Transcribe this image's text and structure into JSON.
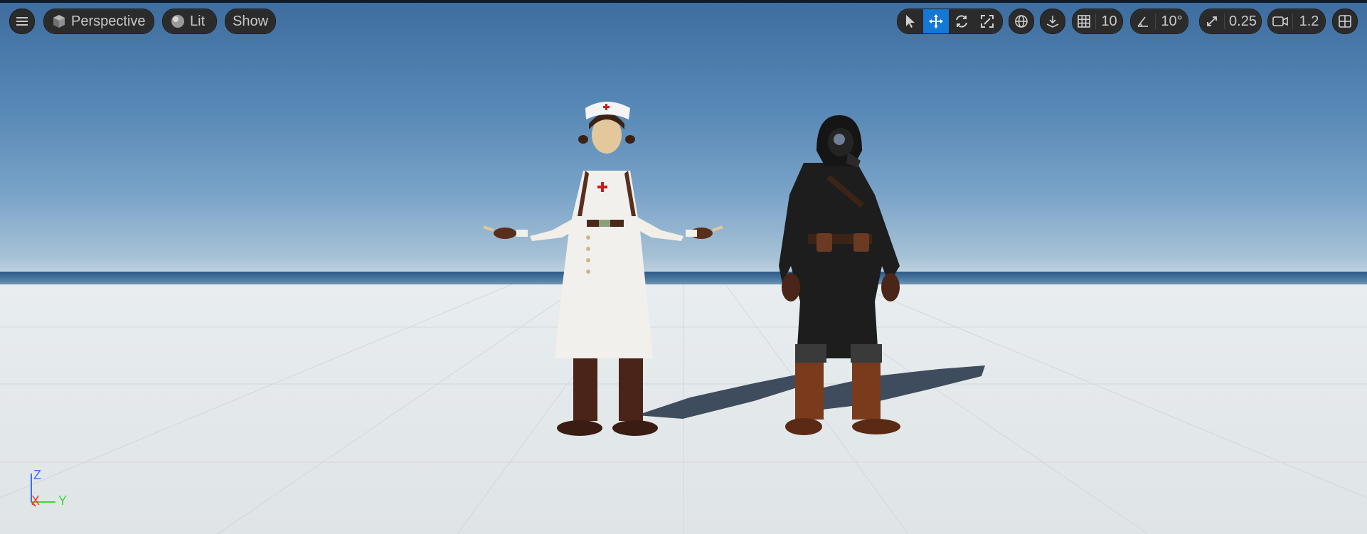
{
  "toolbar": {
    "menu_icon": "hamburger-menu-icon",
    "perspective_label": "Perspective",
    "lit_label": "Lit",
    "show_label": "Show",
    "grid_snap_value": "10",
    "rotation_snap_value": "10°",
    "scale_snap_value": "0.25",
    "camera_speed_value": "1.2",
    "accent_color": "#1577d6"
  },
  "axis_gizmo": {
    "z_label": "Z",
    "x_label": "X",
    "y_label": "Y",
    "z_color": "#3b6cff",
    "x_color": "#ff3a2e",
    "y_color": "#44d33a"
  }
}
